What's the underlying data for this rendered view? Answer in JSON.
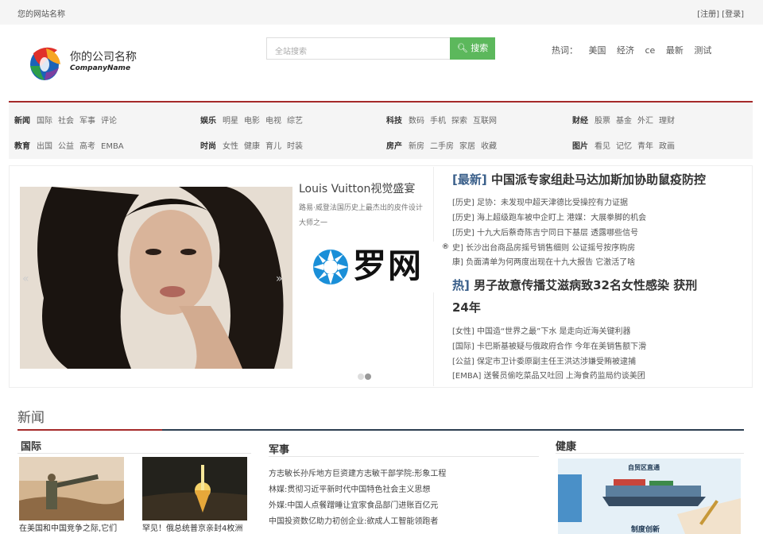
{
  "topbar": {
    "site_name": "您的网站名称",
    "register": "[注册]",
    "login": "[登录]"
  },
  "header": {
    "company_name": "你的公司名称",
    "company_name_en": "CompanyName",
    "search_placeholder": "全站搜索",
    "search_button": "搜索",
    "hot_label": "热词：",
    "hot_words": [
      "美国",
      "经济",
      "ce",
      "最新",
      "测试"
    ]
  },
  "categories": {
    "row1": [
      {
        "title": "新闻",
        "items": [
          "国际",
          "社会",
          "军事",
          "评论"
        ]
      },
      {
        "title": "娱乐",
        "items": [
          "明星",
          "电影",
          "电视",
          "综艺"
        ]
      },
      {
        "title": "科技",
        "items": [
          "数码",
          "手机",
          "探索",
          "互联网"
        ]
      },
      {
        "title": "财经",
        "items": [
          "股票",
          "基金",
          "外汇",
          "理财"
        ]
      }
    ],
    "row2": [
      {
        "title": "教育",
        "items": [
          "出国",
          "公益",
          "高考",
          "EMBA"
        ]
      },
      {
        "title": "时尚",
        "items": [
          "女性",
          "健康",
          "育儿",
          "时装"
        ]
      },
      {
        "title": "房产",
        "items": [
          "新房",
          "二手房",
          "家居",
          "收藏"
        ]
      },
      {
        "title": "图片",
        "items": [
          "看见",
          "记忆",
          "青年",
          "政画"
        ]
      }
    ]
  },
  "slider": {
    "title": "Louis Vuitton视觉盛宴",
    "desc": "路易·威登法国历史上最杰出的皮件设计大师之一",
    "prev": "«",
    "next": "»"
  },
  "watermark": {
    "text": "罗网",
    "reg": "®"
  },
  "news_panel": {
    "headline1_tag": "[最新]",
    "headline1": "中国派专家组赴马达加斯加协助鼠疫防控",
    "list1": [
      "[历史] 足协：未发现中超天津德比受操控有力证据",
      "[历史] 海上超级跑车被中企盯上 港媒：大展拳脚的机会",
      "[历史] 十九大后蔡奇陈吉宁同日下基层 透露哪些信号",
      "史] 长沙出台商品房摇号销售细则 公证摇号按序购房",
      "康] 负面清单为何两度出现在十九大报告 它激活了啥"
    ],
    "headline2_tag": "热]",
    "headline2a": "男子故意传播艾滋病致32名女性感染 获刑",
    "headline2b": "24年",
    "list2": [
      "[女性] 中国造“世界之最”下水 是走向近海关键利器",
      "[国际] 卡巴斯基被疑与俄政府合作 今年在美销售额下滑",
      "[公益] 保定市卫计委原副主任王洪达涉嫌受贿被逮捕",
      "[EMBA] 送餐员偷吃菜品又吐回 上海食药监局约谈美团"
    ]
  },
  "section": {
    "title": "新闻",
    "col1_head": "国际",
    "col2_head": "军事",
    "col3_head": "健康",
    "thumb1_caption": "在美国和中国竞争之际,它们",
    "thumb2_caption": "罕见！俄总统普京亲封4枚洲",
    "military": [
      "方志敏长孙斥地方巨资建方志敏干部学院:形象工程",
      "林媒:贯彻习近平新时代中国特色社会主义思想",
      "外媒:中国人点餐蹭睡让宜家食品部门进账百亿元",
      "中国投资数亿助力初创企业:欲成人工智能领跑者"
    ],
    "health_img_top": "自贸区直通",
    "health_img_bottom": "制度创新"
  }
}
